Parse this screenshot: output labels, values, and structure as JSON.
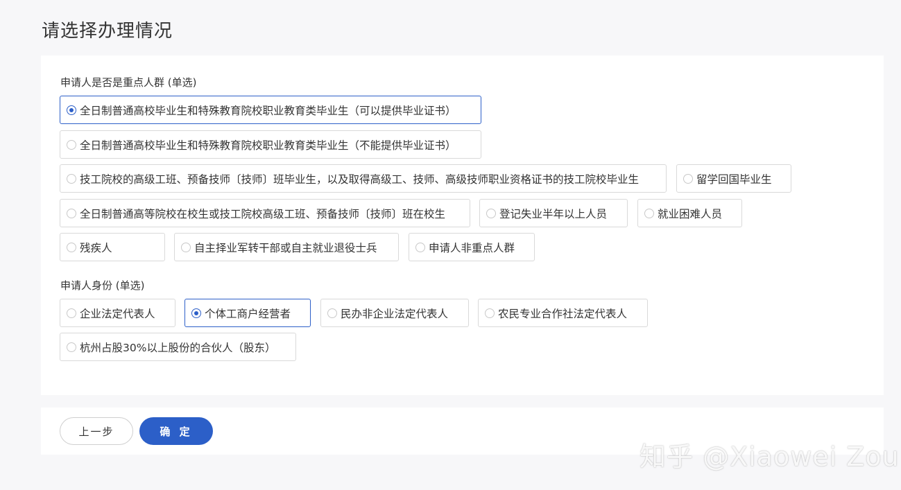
{
  "page": {
    "title": "请选择办理情况"
  },
  "group1": {
    "label": "申请人是否是重点人群 (单选)",
    "options": [
      {
        "label": "全日制普通高校毕业生和特殊教育院校职业教育类毕业生（可以提供毕业证书）",
        "selected": true
      },
      {
        "label": "全日制普通高校毕业生和特殊教育院校职业教育类毕业生（不能提供毕业证书）",
        "selected": false
      },
      {
        "label": "技工院校的高级工班、预备技师〔技师〕班毕业生，以及取得高级工、技师、高级技师职业资格证书的技工院校毕业生",
        "selected": false
      },
      {
        "label": "留学回国毕业生",
        "selected": false
      },
      {
        "label": "全日制普通高等院校在校生或技工院校高级工班、预备技师〔技师〕班在校生",
        "selected": false
      },
      {
        "label": "登记失业半年以上人员",
        "selected": false
      },
      {
        "label": "就业困难人员",
        "selected": false
      },
      {
        "label": "残疾人",
        "selected": false
      },
      {
        "label": "自主择业军转干部或自主就业退役士兵",
        "selected": false
      },
      {
        "label": "申请人非重点人群",
        "selected": false
      }
    ]
  },
  "group2": {
    "label": "申请人身份 (单选)",
    "options": [
      {
        "label": "企业法定代表人",
        "selected": false
      },
      {
        "label": "个体工商户经营者",
        "selected": true
      },
      {
        "label": "民办非企业法定代表人",
        "selected": false
      },
      {
        "label": "农民专业合作社法定代表人",
        "selected": false
      },
      {
        "label": "杭州占股30%以上股份的合伙人（股东）",
        "selected": false
      }
    ]
  },
  "actions": {
    "prev_label": "上一步",
    "confirm_label": "确 定"
  },
  "watermark": {
    "text": "知乎 @Xiaowei Zou"
  },
  "colors": {
    "accent": "#2c5fc8",
    "background": "#f7f7f9",
    "card": "#ffffff",
    "border": "#d9d9d9"
  }
}
